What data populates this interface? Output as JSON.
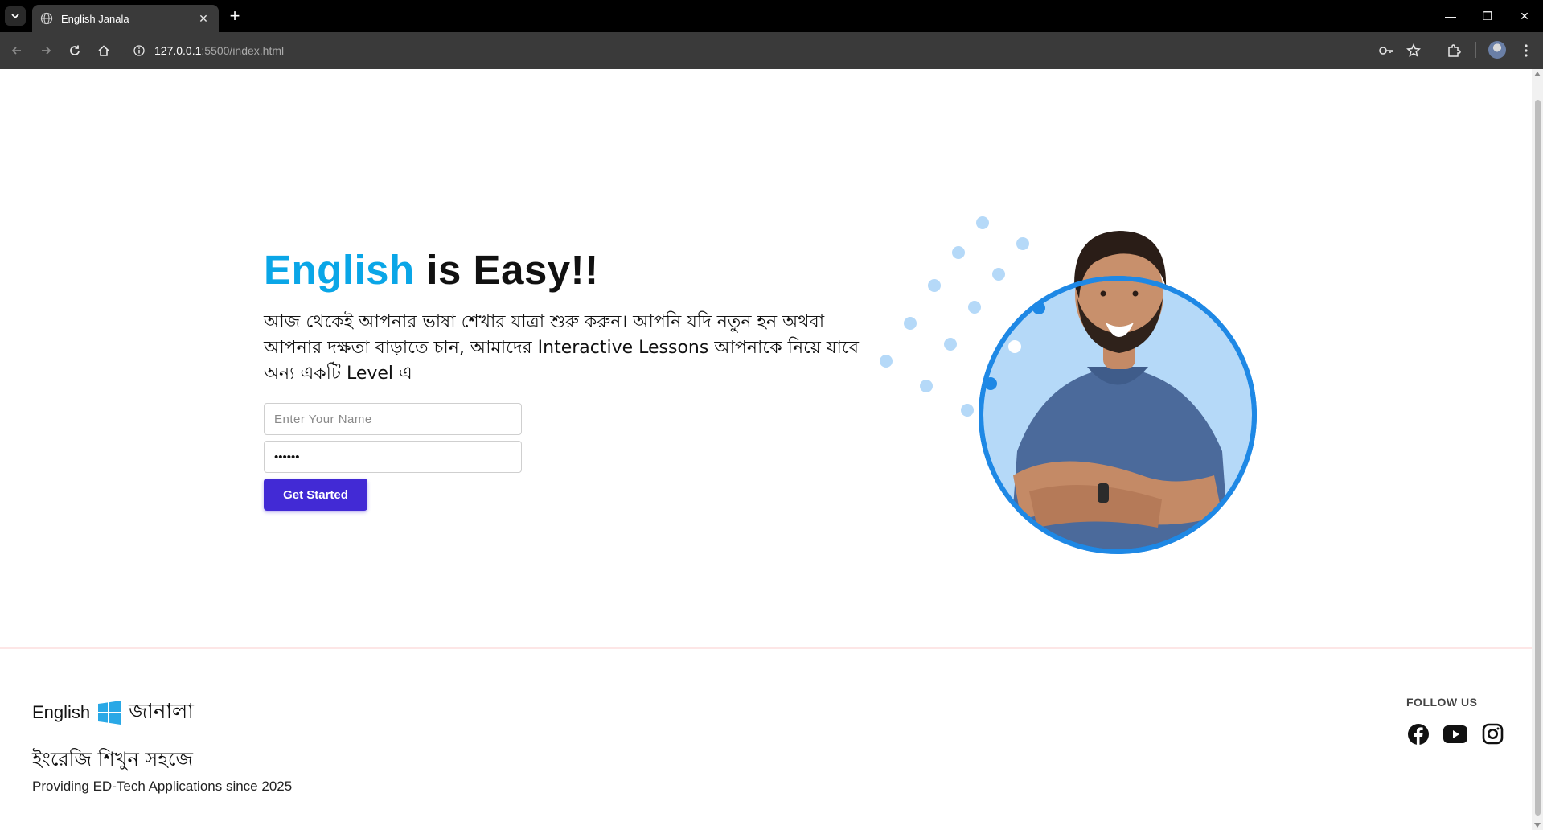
{
  "browser": {
    "tab_title": "English Janala",
    "url_host": "127.0.0.1",
    "url_rest": ":5500/index.html"
  },
  "hero": {
    "title_accent": "English",
    "title_rest": " is Easy!!",
    "description": "আজ থেকেই আপনার ভাষা শেখার যাত্রা শুরু করুন। আপনি যদি নতুন হন অথবা আপনার দক্ষতা বাড়াতে চান, আমাদের Interactive Lessons আপনাকে নিয়ে যাবে অন্য একটি Level এ",
    "name_placeholder": "Enter Your Name",
    "password_value": "123456",
    "cta_label": "Get Started"
  },
  "footer": {
    "logo_en": "English",
    "logo_bn": "জানালা",
    "tagline": "ইংরেজি শিখুন সহজে",
    "since": "Providing ED-Tech Applications since 2025",
    "follow_label": "FOLLOW US"
  },
  "colors": {
    "accent": "#0aa6e7",
    "cta": "#422ad5",
    "circle_ring": "#1e88e5",
    "circle_fill": "#b5d9f8"
  },
  "icons": [
    "globe-icon",
    "facebook-icon",
    "youtube-icon",
    "instagram-icon",
    "windows-logo-icon"
  ]
}
